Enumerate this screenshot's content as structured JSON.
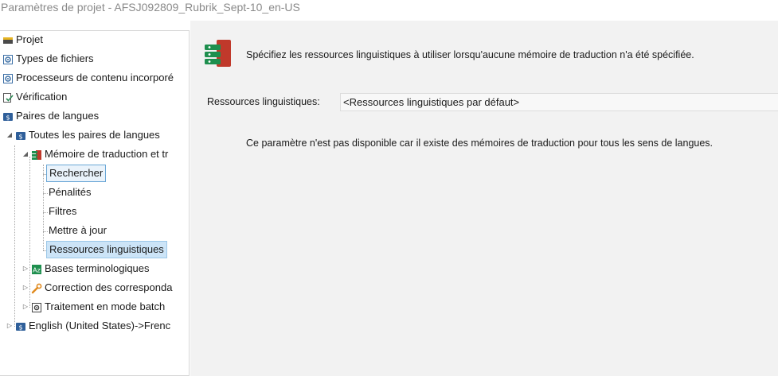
{
  "window": {
    "title": "Paramètres de projet - AFSJ092809_Rubrik_Sept-10_en-US"
  },
  "tree": {
    "projet": "Projet",
    "types_fichiers": "Types de fichiers",
    "processeurs": "Processeurs de contenu incorporé",
    "verification": "Vérification",
    "paires_langues": "Paires de langues",
    "toutes_paires": "Toutes les paires de langues",
    "memoire": "Mémoire de traduction et tr",
    "rechercher": "Rechercher",
    "penalites": "Pénalités",
    "filtres": "Filtres",
    "mettre_a_jour": "Mettre à jour",
    "ressources": "Ressources linguistiques",
    "bases_terminologiques": "Bases terminologiques",
    "correction": "Correction des correspondа",
    "traitement": "Traitement en mode batch",
    "english_pair": "English (United States)->Frenc"
  },
  "main": {
    "header_text": "Spécifiez les ressources linguistiques à utiliser lorsqu'aucune mémoire de traduction n'a été spécifiée.",
    "field_label": "Ressources linguistiques:",
    "field_value": "<Ressources linguistiques par défaut>",
    "note": "Ce paramètre n'est pas disponible car il existe des mémoires de traduction pour tous les sens de langues."
  },
  "colors": {
    "selection_fill": "#cce4f7",
    "selection_outline": "#6aa7d6",
    "content_bg": "#f2f2f2",
    "tm_icon_green": "#1e8f4e",
    "tm_icon_red": "#c0392b"
  }
}
